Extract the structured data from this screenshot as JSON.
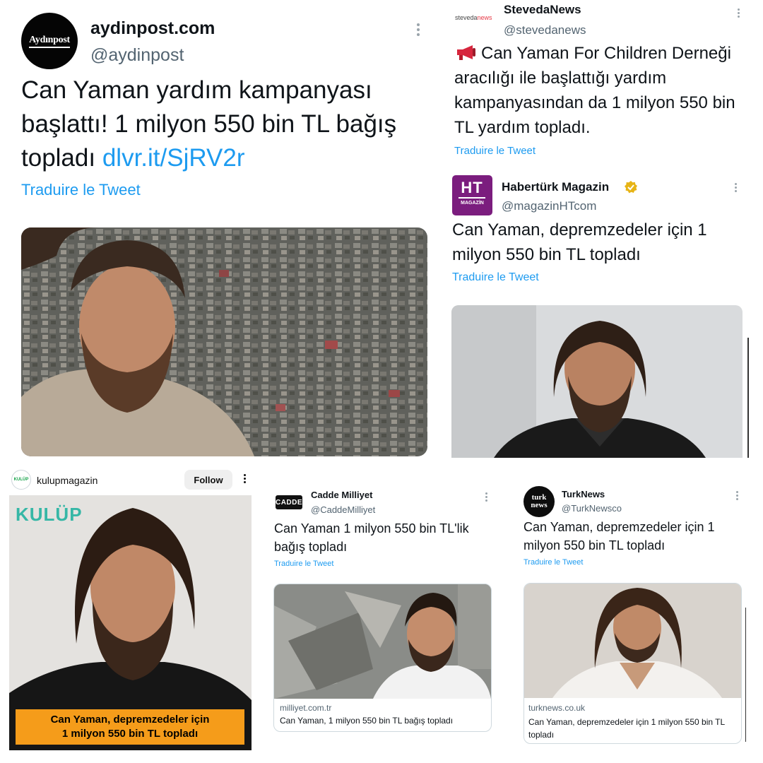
{
  "panels": {
    "aydinpost": {
      "avatar_text": "Aydınpost",
      "name": "aydinpost.com",
      "handle": "@aydinpost",
      "text": "Can Yaman yardım kampanyası başlattı! 1 milyon 550 bin TL bağış topladı",
      "link": "dlvr.it/SjRV2r",
      "translate": "Traduire le Tweet"
    },
    "stevedanews": {
      "logo_text_a": "steveda",
      "logo_text_b": "news",
      "name": "StevedaNews",
      "handle": "@stevedanews",
      "text": "Can Yaman For Children Derneği aracılığı ile başlattığı yardım kampanyasından da 1 milyon 550 bin TL yardım topladı.",
      "translate": "Traduire le Tweet"
    },
    "haberturk": {
      "avatar_ht": "HT",
      "avatar_sub": "MAGAZİN",
      "name": "Habertürk Magazin",
      "handle": "@magazinHTcom",
      "text": "Can Yaman, depremzedeler için 1 milyon 550 bin TL topladı",
      "translate": "Traduire le Tweet"
    },
    "kulupmagazin": {
      "avatar_text": "KULÜP",
      "username": "kulupmagazin",
      "follow": "Follow",
      "logo": "KULÜP",
      "banner_line1": "Can Yaman, depremzedeler için",
      "banner_line2": "1 milyon 550 bin TL topladı"
    },
    "caddemilliyet": {
      "avatar_text": "CADDE",
      "name": "Cadde Milliyet",
      "handle": "@CaddeMilliyet",
      "text": "Can Yaman 1 milyon 550 bin TL'lik bağış topladı",
      "translate": "Traduire le Tweet",
      "card_domain": "milliyet.com.tr",
      "card_title": "Can Yaman, 1 milyon 550 bin TL bağış topladı"
    },
    "turknews": {
      "avatar_line1": "turk",
      "avatar_line2": "news",
      "name": "TurkNews",
      "handle": "@TurkNewsco",
      "text": "Can Yaman, depremzedeler için 1 milyon 550 bin TL topladı",
      "translate": "Traduire le Tweet",
      "card_domain": "turknews.co.uk",
      "card_title": "Can Yaman, depremzedeler için 1 milyon 550 bin TL topladı"
    }
  },
  "colors": {
    "link": "#1d9bf0",
    "haberturk_purple": "#7b1d7e",
    "kulup_orange": "#f59c1a",
    "kulup_teal": "#36b7a6",
    "verified_gold": "#e7b416"
  }
}
